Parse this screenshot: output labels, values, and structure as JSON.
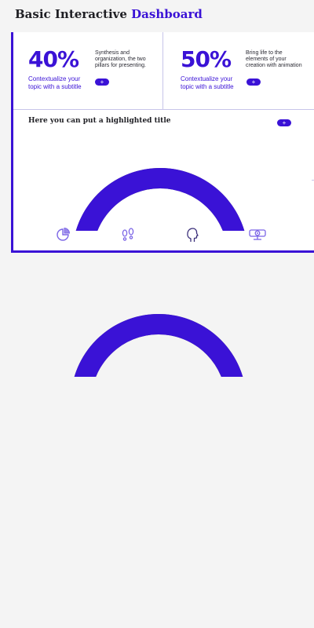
{
  "page": {
    "title_part1": "Basic Interactive ",
    "title_part2": "Dashboard"
  },
  "colors": {
    "accent": "#3a12d6",
    "remainder": "#5b5a67",
    "needle": "#2f2f3a",
    "divider": "#c7c5ea"
  },
  "kpis": [
    {
      "value": "40%",
      "subtitle": "Contextualize your topic with a subtitle",
      "description": "Synthesis and organization, the two pillars for presenting.",
      "button": "+"
    },
    {
      "value": "50%",
      "subtitle": "Contextualize your topic with a subtitle",
      "description": "Bring life to the elements of your creation with animation",
      "button": "+"
    }
  ],
  "panel": {
    "title": "Here you can put a highlighted title",
    "button": "+",
    "icons": [
      "pie-chart-icon",
      "footprints-icon",
      "head-icon",
      "projector-icon"
    ]
  },
  "gauges": [
    {
      "fill_fraction": 0.95
    },
    {
      "fill_fraction": 0.93
    }
  ]
}
